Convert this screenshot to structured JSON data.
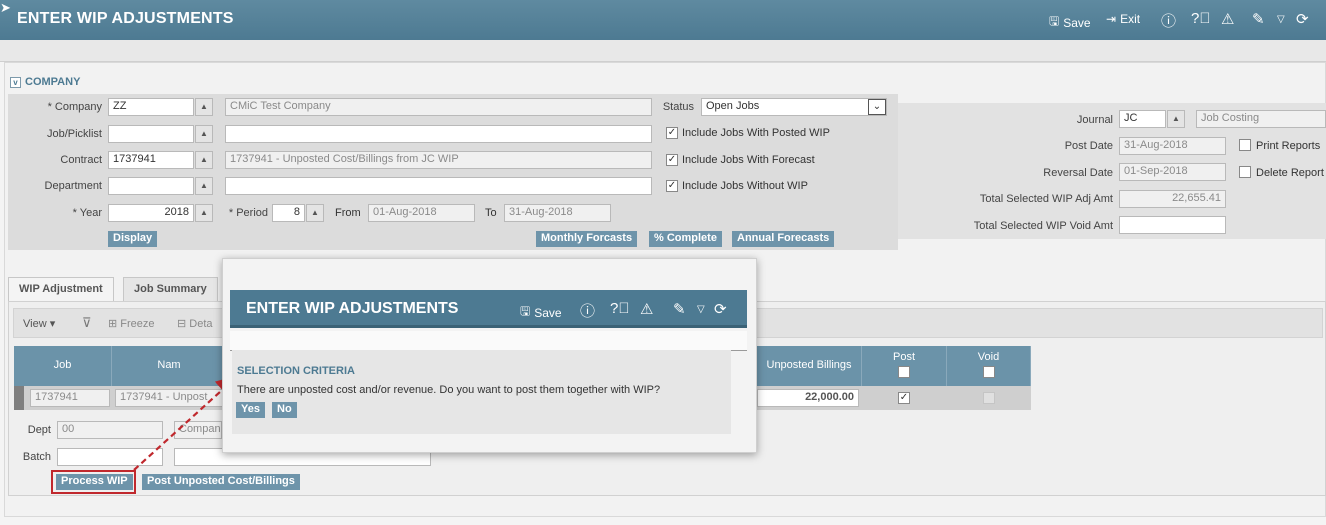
{
  "header": {
    "title": "ENTER WIP ADJUSTMENTS",
    "save_label": "Save",
    "exit_label": "Exit"
  },
  "company_section": {
    "heading": "COMPANY",
    "company_label": "* Company",
    "company_code": "ZZ",
    "company_name": "CMiC Test Company",
    "jobpicklist_label": "Job/Picklist",
    "contract_label": "Contract",
    "contract_code": "1737941",
    "contract_name": "1737941 - Unposted Cost/Billings from JC WIP",
    "department_label": "Department",
    "year_label": "* Year",
    "year_value": "2018",
    "period_label": "* Period",
    "period_value": "8",
    "from_label": "From",
    "from_value": "01-Aug-2018",
    "to_label": "To",
    "to_value": "31-Aug-2018",
    "display_button": "Display",
    "status_label": "Status",
    "status_value": "Open Jobs",
    "chk_posted_wip": "Include Jobs With Posted WIP",
    "chk_forecast": "Include Jobs With Forecast",
    "chk_without_wip": "Include Jobs Without WIP",
    "monthly_forecasts": "Monthly Forcasts",
    "pct_complete": "% Complete",
    "annual_forecasts": "Annual Forecasts"
  },
  "right_section": {
    "journal_label": "Journal",
    "journal_code": "JC",
    "journal_name": "Job Costing",
    "post_date_label": "Post Date",
    "post_date": "31-Aug-2018",
    "reversal_date_label": "Reversal Date",
    "reversal_date": "01-Sep-2018",
    "print_reports": "Print Reports",
    "delete_reports": "Delete Report",
    "total_adj_label": "Total Selected WIP Adj Amt",
    "total_adj_value": "22,655.41",
    "total_void_label": "Total Selected WIP Void Amt"
  },
  "tabs": [
    "WIP Adjustment",
    "Job Summary"
  ],
  "grid_toolbar": {
    "view": "View",
    "freeze": "Freeze",
    "detach": "Deta"
  },
  "grid": {
    "col_job": "Job",
    "col_name": "Nam",
    "col_unposted_billings": "Unposted Billings",
    "col_post": "Post",
    "col_void": "Void",
    "row_job": "1737941",
    "row_name": "1737941 - Unpost",
    "row_unposted_billings": "22,000.00"
  },
  "footer_form": {
    "dept_label": "Dept",
    "dept_value": "00",
    "company_partial": "Compan",
    "batch_label": "Batch",
    "process_wip": "Process WIP",
    "post_unposted": "Post Unposted Cost/Billings"
  },
  "dialog": {
    "title": "ENTER WIP ADJUSTMENTS",
    "save_label": "Save",
    "section": "SELECTION CRITERIA",
    "message": "There are unposted cost and/or revenue. Do you want to post them together with WIP?",
    "yes": "Yes",
    "no": "No"
  },
  "colors": {
    "header": "#4d7a92",
    "button": "#6e94aa",
    "annotation": "#c0282d"
  }
}
